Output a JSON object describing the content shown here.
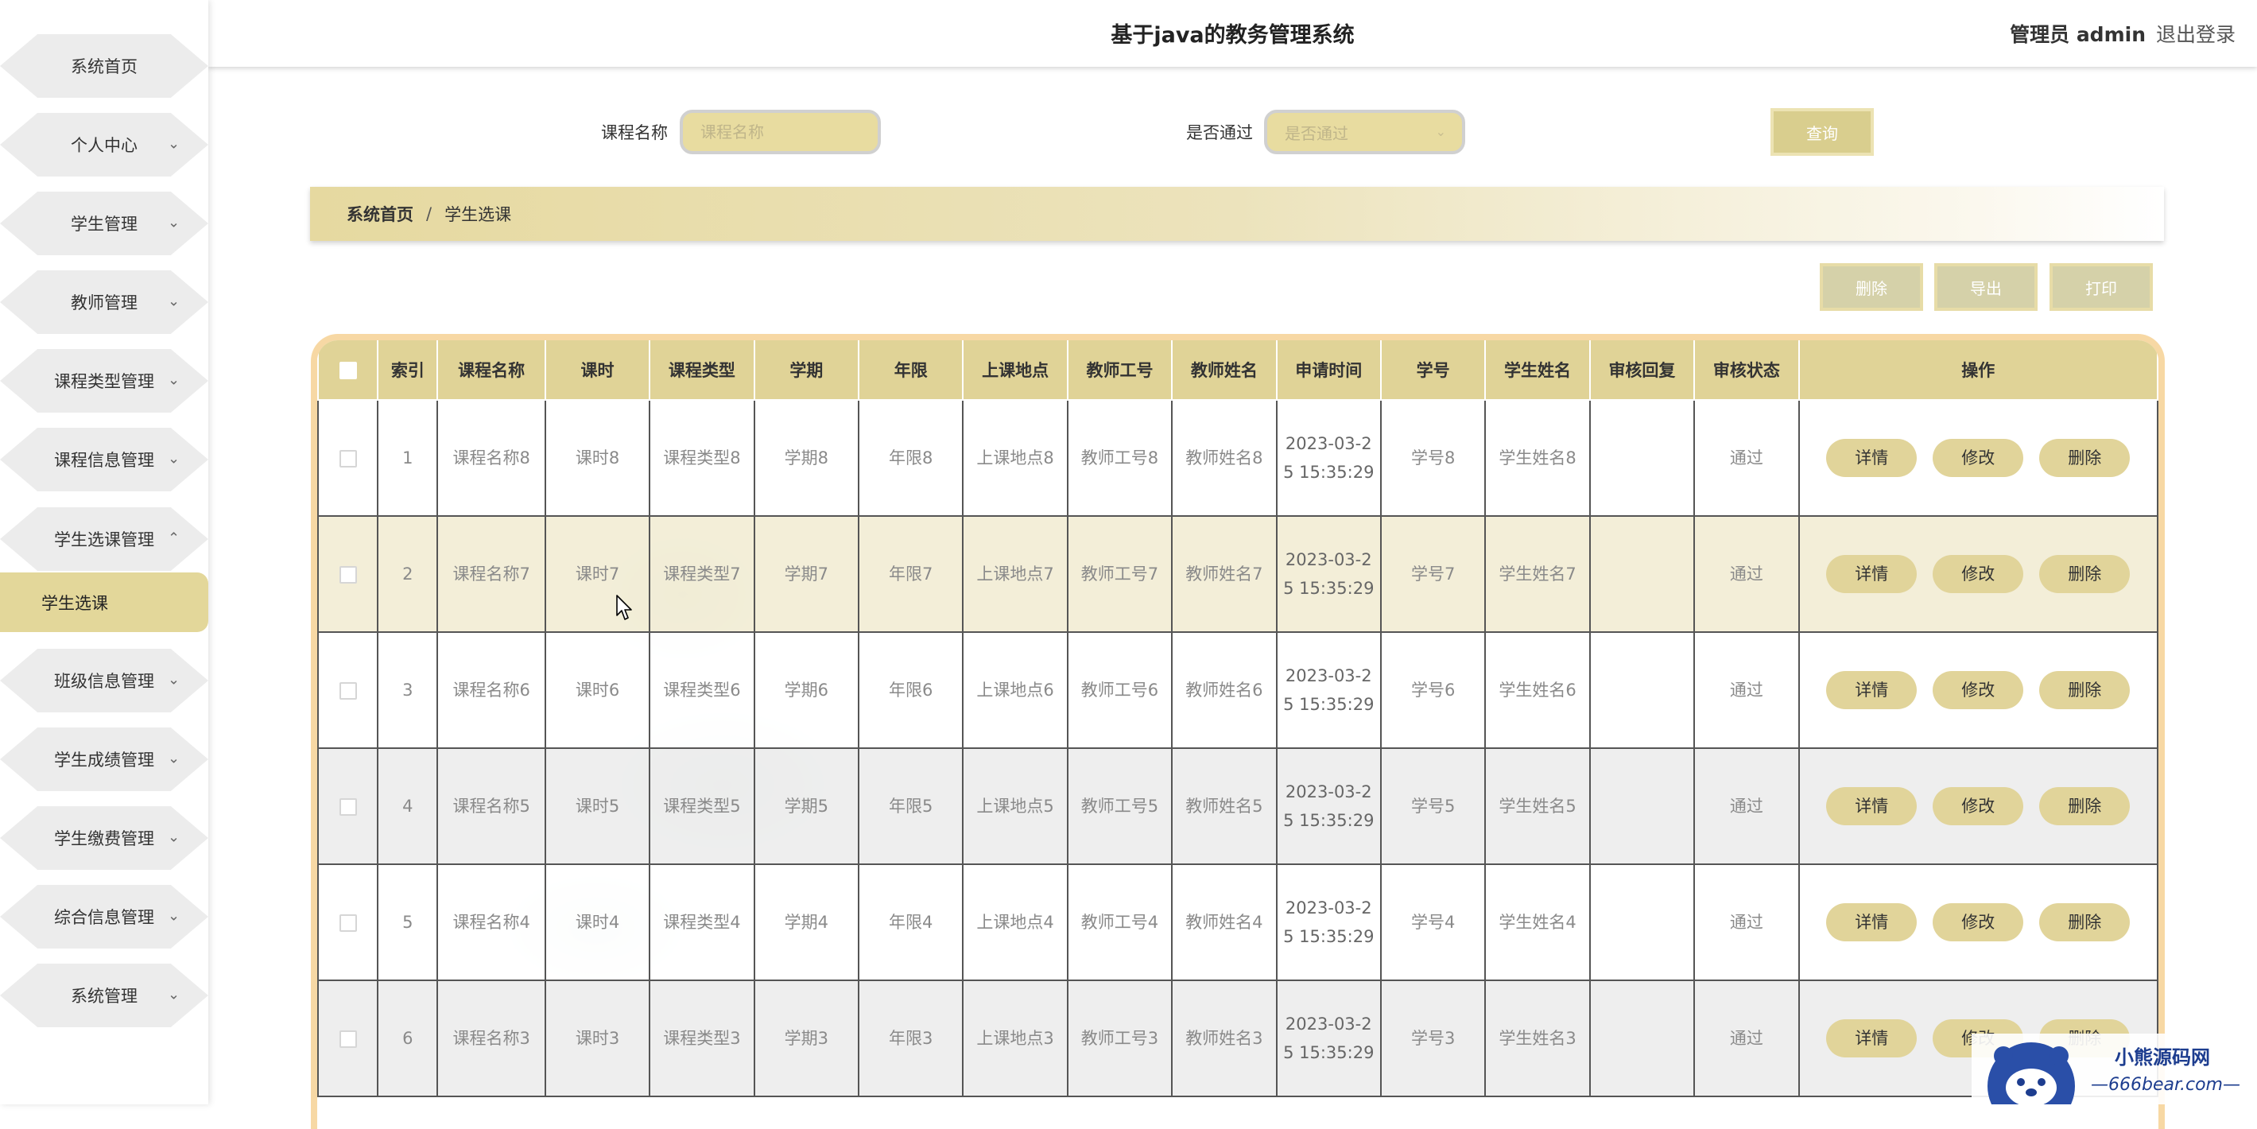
{
  "app": {
    "title": "基于java的教务管理系统",
    "user": "管理员 admin",
    "logout": "退出登录"
  },
  "sidebar": {
    "items": [
      {
        "label": "系统首页",
        "icon": ""
      },
      {
        "label": "个人中心",
        "icon": "chevron-down-icon"
      },
      {
        "label": "学生管理",
        "icon": "chevron-down-icon"
      },
      {
        "label": "教师管理",
        "icon": "chevron-down-icon"
      },
      {
        "label": "课程类型管理",
        "icon": "chevron-down-icon"
      },
      {
        "label": "课程信息管理",
        "icon": "chevron-down-icon"
      },
      {
        "label": "学生选课管理",
        "icon": "chevron-up-icon"
      },
      {
        "label": "班级信息管理",
        "icon": "chevron-down-icon"
      },
      {
        "label": "学生成绩管理",
        "icon": "chevron-down-icon"
      },
      {
        "label": "学生缴费管理",
        "icon": "chevron-down-icon"
      },
      {
        "label": "综合信息管理",
        "icon": "chevron-down-icon"
      },
      {
        "label": "系统管理",
        "icon": "chevron-down-icon"
      }
    ],
    "active_sub": "学生选课"
  },
  "search": {
    "course_label": "课程名称",
    "course_placeholder": "课程名称",
    "pass_label": "是否通过",
    "pass_placeholder": "是否通过",
    "query_button": "查询"
  },
  "breadcrumb": {
    "home": "系统首页",
    "separator": "/",
    "current": "学生选课"
  },
  "actions": {
    "delete": "删除",
    "export": "导出",
    "print": "打印"
  },
  "table": {
    "headers": [
      "索引",
      "课程名称",
      "课时",
      "课程类型",
      "学期",
      "年限",
      "上课地点",
      "教师工号",
      "教师姓名",
      "申请时间",
      "学号",
      "学生姓名",
      "审核回复",
      "审核状态",
      "操作"
    ],
    "row_buttons": {
      "detail": "详情",
      "edit": "修改",
      "delete": "删除"
    },
    "rows": [
      {
        "index": "1",
        "course": "课程名称8",
        "hours": "课时8",
        "type": "课程类型8",
        "term": "学期8",
        "years": "年限8",
        "location": "上课地点8",
        "teacher_id": "教师工号8",
        "teacher_name": "教师姓名8",
        "apply_time": "2023-03-25 15:35:29",
        "student_id": "学号8",
        "student_name": "学生姓名8",
        "reply": "",
        "status": "通过"
      },
      {
        "index": "2",
        "course": "课程名称7",
        "hours": "课时7",
        "type": "课程类型7",
        "term": "学期7",
        "years": "年限7",
        "location": "上课地点7",
        "teacher_id": "教师工号7",
        "teacher_name": "教师姓名7",
        "apply_time": "2023-03-25 15:35:29",
        "student_id": "学号7",
        "student_name": "学生姓名7",
        "reply": "",
        "status": "通过"
      },
      {
        "index": "3",
        "course": "课程名称6",
        "hours": "课时6",
        "type": "课程类型6",
        "term": "学期6",
        "years": "年限6",
        "location": "上课地点6",
        "teacher_id": "教师工号6",
        "teacher_name": "教师姓名6",
        "apply_time": "2023-03-25 15:35:29",
        "student_id": "学号6",
        "student_name": "学生姓名6",
        "reply": "",
        "status": "通过"
      },
      {
        "index": "4",
        "course": "课程名称5",
        "hours": "课时5",
        "type": "课程类型5",
        "term": "学期5",
        "years": "年限5",
        "location": "上课地点5",
        "teacher_id": "教师工号5",
        "teacher_name": "教师姓名5",
        "apply_time": "2023-03-25 15:35:29",
        "student_id": "学号5",
        "student_name": "学生姓名5",
        "reply": "",
        "status": "通过"
      },
      {
        "index": "5",
        "course": "课程名称4",
        "hours": "课时4",
        "type": "课程类型4",
        "term": "学期4",
        "years": "年限4",
        "location": "上课地点4",
        "teacher_id": "教师工号4",
        "teacher_name": "教师姓名4",
        "apply_time": "2023-03-25 15:35:29",
        "student_id": "学号4",
        "student_name": "学生姓名4",
        "reply": "",
        "status": "通过"
      },
      {
        "index": "6",
        "course": "课程名称3",
        "hours": "课时3",
        "type": "课程类型3",
        "term": "学期3",
        "years": "年限3",
        "location": "上课地点3",
        "teacher_id": "教师工号3",
        "teacher_name": "教师姓名3",
        "apply_time": "2023-03-25 15:35:29",
        "student_id": "学号3",
        "student_name": "学生姓名3",
        "reply": "",
        "status": "通过"
      }
    ]
  },
  "watermark": {
    "name": "小熊源码网",
    "url": "—666bear.com—"
  }
}
